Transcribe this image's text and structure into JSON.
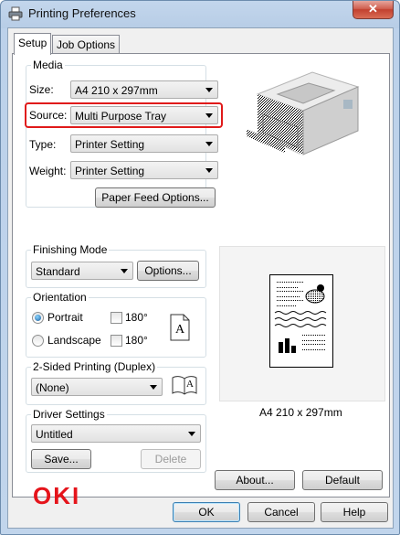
{
  "window": {
    "title": "Printing Preferences",
    "close_label": "✕"
  },
  "tabs": [
    {
      "label": "Setup"
    },
    {
      "label": "Job Options"
    }
  ],
  "media": {
    "group_label": "Media",
    "size_label": "Size:",
    "size_value": "A4 210 x 297mm",
    "source_label": "Source:",
    "source_value": "Multi Purpose Tray",
    "type_label": "Type:",
    "type_value": "Printer Setting",
    "weight_label": "Weight:",
    "weight_value": "Printer Setting",
    "paper_feed_button": "Paper Feed Options..."
  },
  "finishing": {
    "group_label": "Finishing Mode",
    "mode_value": "Standard",
    "options_button": "Options..."
  },
  "orientation": {
    "group_label": "Orientation",
    "portrait_label": "Portrait",
    "landscape_label": "Landscape",
    "rotate_label_1": "180°",
    "rotate_label_2": "180°",
    "selected": "Portrait",
    "page_icon_letter": "A"
  },
  "duplex": {
    "group_label": "2-Sided Printing (Duplex)",
    "value": "(None)",
    "book_icon_letter": "A"
  },
  "driver": {
    "group_label": "Driver Settings",
    "value": "Untitled",
    "save_button": "Save...",
    "delete_button": "Delete"
  },
  "preview": {
    "paper_size_caption": "A4 210 x 297mm"
  },
  "brand": {
    "logo_text": "OKI",
    "color": "#e5141b"
  },
  "panel_buttons": {
    "about": "About...",
    "default": "Default"
  },
  "dialog_buttons": {
    "ok": "OK",
    "cancel": "Cancel",
    "help": "Help"
  }
}
